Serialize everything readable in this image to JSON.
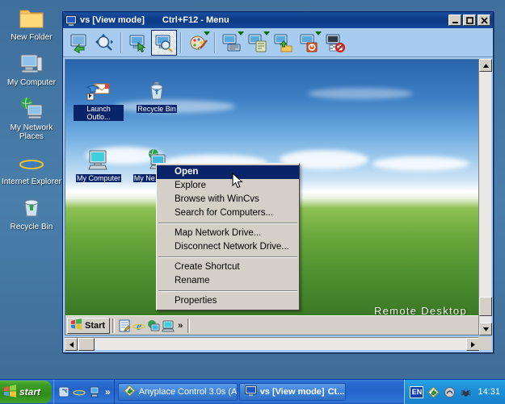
{
  "host_desktop": {
    "icons": [
      {
        "label": "New Folder",
        "icon": "folder-icon"
      },
      {
        "label": "My Computer",
        "icon": "my-computer-icon"
      },
      {
        "label": "My Network Places",
        "icon": "my-network-places-icon"
      },
      {
        "label": "Internet Explorer",
        "icon": "internet-explorer-icon"
      },
      {
        "label": "Recycle Bin",
        "icon": "recycle-bin-icon"
      }
    ]
  },
  "viewer_window": {
    "title": "vs [View mode]",
    "subtitle": "Ctrl+F12 - Menu",
    "title_icon": "monitor-icon",
    "window_buttons": {
      "minimize": "minimize-button",
      "maximize": "maximize-button",
      "close": "close-button"
    },
    "toolbar": {
      "buttons": [
        {
          "name": "connect-button",
          "icon": "connect-icon",
          "has_dropdown": false,
          "pressed": false
        },
        {
          "name": "search-hosts-button",
          "icon": "magnifier-icon",
          "has_dropdown": false,
          "pressed": false
        },
        {
          "name": "control-mode-button",
          "icon": "monitor-cursor-icon",
          "has_dropdown": false,
          "pressed": false
        },
        {
          "name": "view-mode-button",
          "icon": "monitor-glass-icon",
          "has_dropdown": false,
          "pressed": true
        },
        {
          "name": "screen-options-button",
          "icon": "palette-icon",
          "has_dropdown": true,
          "pressed": false
        },
        {
          "name": "send-keys-button",
          "icon": "monitor-keyboard-icon",
          "has_dropdown": true,
          "pressed": false
        },
        {
          "name": "clipboard-button",
          "icon": "monitor-clipboard-icon",
          "has_dropdown": true,
          "pressed": false
        },
        {
          "name": "file-transfer-button",
          "icon": "monitor-folder-icon",
          "has_dropdown": false,
          "pressed": false
        },
        {
          "name": "power-button",
          "icon": "monitor-power-icon",
          "has_dropdown": true,
          "pressed": false
        },
        {
          "name": "disconnect-button",
          "icon": "monitor-disconnect-icon",
          "has_dropdown": false,
          "pressed": false
        }
      ]
    },
    "scrollbars": {
      "vertical": {
        "up": "scroll-up-arrow",
        "down": "scroll-down-arrow"
      },
      "horizontal": {
        "left": "scroll-left-arrow",
        "right": "scroll-right-arrow"
      }
    }
  },
  "remote_desktop": {
    "watermark": "Remote Desktop",
    "icons": [
      {
        "label": "Launch Outlo...",
        "icon": "outlook-shortcut-icon"
      },
      {
        "label": "Recycle Bin",
        "icon": "recycle-bin-icon"
      },
      {
        "label": "My Computer",
        "icon": "my-computer-icon"
      },
      {
        "label": "My Ne...\nPla...",
        "icon": "my-network-places-icon"
      }
    ],
    "taskbar": {
      "start_label": "Start",
      "start_icon": "windows-flag-icon",
      "quicklaunch": [
        {
          "name": "show-desktop-icon",
          "icon": "notepad-icon"
        },
        {
          "name": "internet-explorer-icon",
          "icon": "internet-explorer-icon"
        },
        {
          "name": "outlook-express-icon",
          "icon": "outlook-express-icon"
        },
        {
          "name": "my-computer-icon",
          "icon": "my-computer-icon"
        }
      ],
      "overflow_chevron": "»"
    }
  },
  "context_menu": {
    "items": [
      {
        "label": "Open",
        "selected": true,
        "separator_after": false
      },
      {
        "label": "Explore",
        "selected": false,
        "separator_after": false
      },
      {
        "label": "Browse with WinCvs",
        "selected": false,
        "separator_after": false
      },
      {
        "label": "Search for Computers...",
        "selected": false,
        "separator_after": true
      },
      {
        "label": "Map Network Drive...",
        "selected": false,
        "separator_after": false
      },
      {
        "label": "Disconnect Network Drive...",
        "selected": false,
        "separator_after": true
      },
      {
        "label": "Create Shortcut",
        "selected": false,
        "separator_after": false
      },
      {
        "label": "Rename",
        "selected": false,
        "separator_after": true
      },
      {
        "label": "Properties",
        "selected": false,
        "separator_after": false
      }
    ]
  },
  "host_taskbar": {
    "start_label": "start",
    "start_icon": "windows-flag-icon",
    "quicklaunch": [
      {
        "name": "show-desktop-icon",
        "icon": "show-desktop-icon"
      },
      {
        "name": "internet-explorer-icon",
        "icon": "internet-explorer-icon"
      },
      {
        "name": "my-computer-icon",
        "icon": "my-computer-icon"
      }
    ],
    "overflow_chevron": "»",
    "tasks": [
      {
        "label": "Anyplace Control 3.0s (A...",
        "icon": "anyplace-control-icon",
        "active": false
      },
      {
        "label": "vs [View mode]",
        "suffix": "Ct...",
        "icon": "monitor-icon",
        "active": true
      }
    ],
    "tray": {
      "language": "EN",
      "icons": [
        {
          "name": "anyplace-control-tray-icon"
        },
        {
          "name": "shield-tray-icon"
        },
        {
          "name": "bug-tray-icon"
        }
      ],
      "clock": "14:31"
    }
  },
  "colors": {
    "titlebar": "#0b3a86",
    "menu_highlight": "#0a246a",
    "toolbar_bg": "#a8cbf0",
    "desktop_bg": "#4a7ba7",
    "taskbar_blue": "#2363c9",
    "start_green": "#3d9e26"
  }
}
